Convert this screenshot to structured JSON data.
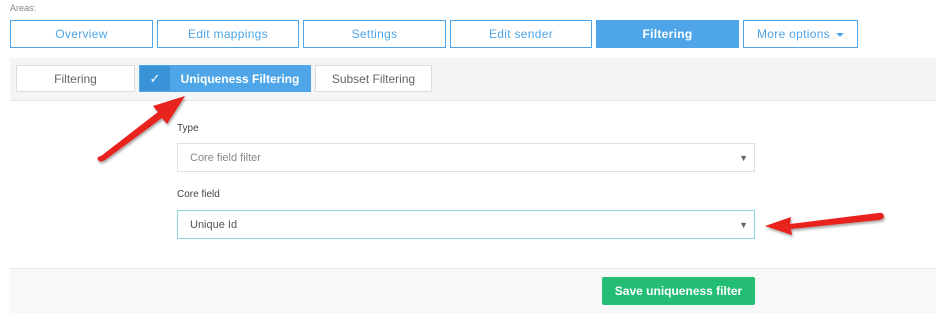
{
  "areas": {
    "label": "Areas:",
    "tabs": [
      {
        "label": "Overview"
      },
      {
        "label": "Edit mappings"
      },
      {
        "label": "Settings"
      },
      {
        "label": "Edit sender"
      },
      {
        "label": "Filtering"
      },
      {
        "label": "More options"
      }
    ],
    "active": "Filtering"
  },
  "subtabs": {
    "items": [
      {
        "label": "Filtering"
      },
      {
        "label": "Uniqueness Filtering"
      },
      {
        "label": "Subset Filtering"
      }
    ],
    "active": "Uniqueness Filtering",
    "check_icon": "✓"
  },
  "form": {
    "type_label": "Type",
    "type_value": "Core field filter",
    "core_field_label": "Core field",
    "core_field_value": "Unique Id",
    "dropdown_arrow": "▼"
  },
  "actions": {
    "save_label": "Save uniqueness filter"
  },
  "colors": {
    "primary": "#4ea6e8",
    "success": "#23bd76",
    "annotation_arrow": "#e8201f"
  }
}
